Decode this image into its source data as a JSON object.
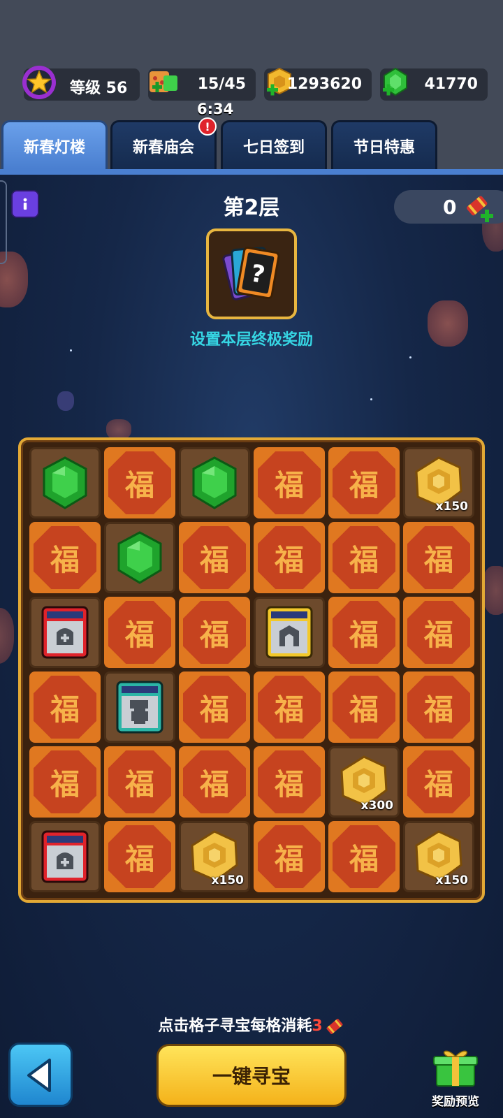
{
  "resources": {
    "level_label": "等级 56",
    "energy": "15/45",
    "coins": "1293620",
    "gems": "41770",
    "timer": "6:34"
  },
  "tabs": [
    {
      "label": "新春灯楼",
      "active": true
    },
    {
      "label": "新春庙会",
      "active": false,
      "badge": "!"
    },
    {
      "label": "七日签到",
      "active": false
    },
    {
      "label": "节日特惠",
      "active": false
    }
  ],
  "event": {
    "floor_title": "第2层",
    "tickets": "0",
    "reward_label": "设置本层终极奖励",
    "cost_hint_prefix": "点击格子寻宝每格消耗",
    "cost_hint_number": "3",
    "search_button": "一键寻宝",
    "reward_preview": "奖励预览"
  },
  "board": {
    "fu_char": "福",
    "cells": [
      {
        "type": "gem"
      },
      {
        "type": "fu"
      },
      {
        "type": "gem"
      },
      {
        "type": "fu"
      },
      {
        "type": "fu"
      },
      {
        "type": "coin",
        "qty": "x150"
      },
      {
        "type": "fu"
      },
      {
        "type": "gem"
      },
      {
        "type": "fu"
      },
      {
        "type": "fu"
      },
      {
        "type": "fu"
      },
      {
        "type": "fu"
      },
      {
        "type": "card-red"
      },
      {
        "type": "fu"
      },
      {
        "type": "fu"
      },
      {
        "type": "card-yellow"
      },
      {
        "type": "fu"
      },
      {
        "type": "fu"
      },
      {
        "type": "fu"
      },
      {
        "type": "card-teal"
      },
      {
        "type": "fu"
      },
      {
        "type": "fu"
      },
      {
        "type": "fu"
      },
      {
        "type": "fu"
      },
      {
        "type": "fu"
      },
      {
        "type": "fu"
      },
      {
        "type": "fu"
      },
      {
        "type": "fu"
      },
      {
        "type": "coin",
        "qty": "x300"
      },
      {
        "type": "fu"
      },
      {
        "type": "card-red"
      },
      {
        "type": "fu"
      },
      {
        "type": "coin",
        "qty": "x150"
      },
      {
        "type": "fu"
      },
      {
        "type": "fu"
      },
      {
        "type": "coin",
        "qty": "x150"
      }
    ]
  }
}
